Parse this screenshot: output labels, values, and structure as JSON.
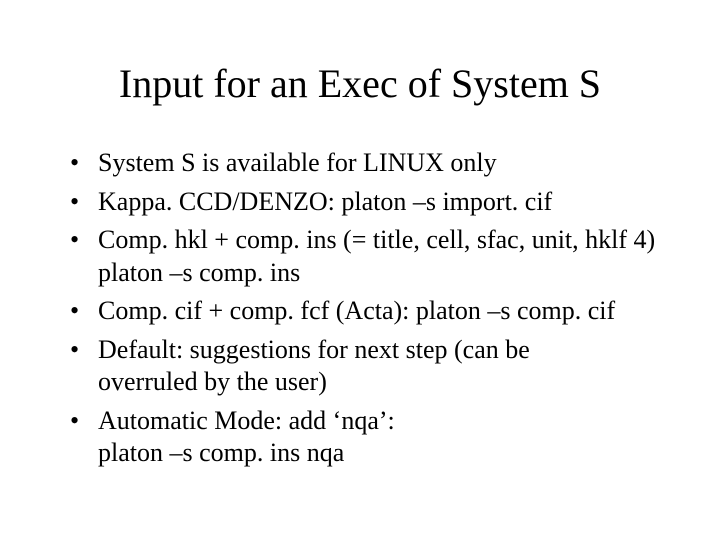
{
  "title": "Input for an Exec of System S",
  "bullets": [
    {
      "line1": "System S is available for LINUX only"
    },
    {
      "line1": "Kappa. CCD/DENZO: platon –s import. cif"
    },
    {
      "line1": "Comp. hkl + comp. ins (= title, cell, sfac, unit, hklf 4)",
      "line2": "platon –s comp. ins"
    },
    {
      "line1": "Comp. cif + comp. fcf (Acta): platon –s comp. cif"
    },
    {
      "line1": "Default: suggestions for next step (can be",
      "line2": "overruled by the user)"
    },
    {
      "line1": "Automatic Mode: add ‘nqa’:",
      "line2": "platon –s comp. ins nqa"
    }
  ]
}
